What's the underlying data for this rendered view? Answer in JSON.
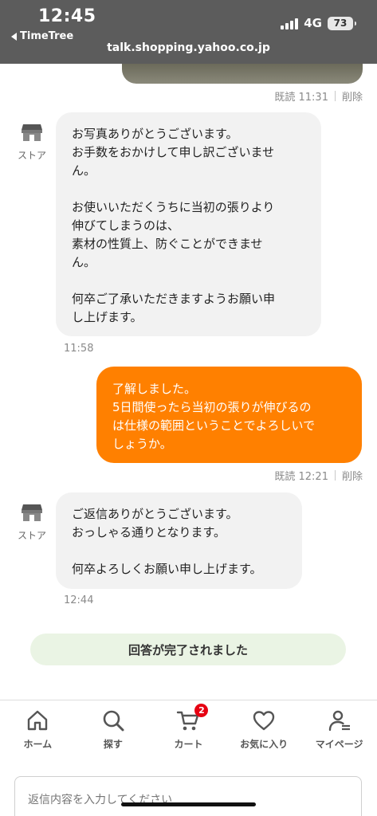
{
  "status_bar": {
    "time": "12:45",
    "back_app": "TimeTree",
    "network": "4G",
    "battery": "73",
    "url": "talk.shopping.yahoo.co.jp"
  },
  "chat": {
    "top_meta": {
      "read": "既読 11:31",
      "delete": "削除"
    },
    "store_label": "ストア",
    "message_1": {
      "text": "お写真ありがとうございます。\nお手数をおかけして申し訳ございませ\nん。\n\nお使いいただくうちに当初の張りより\n伸びてしまうのは、\n素材の性質上、防ぐことができませ\nん。\n\n何卒ご了承いただきますようお願い申\nし上げます。",
      "time": "11:58"
    },
    "reply": {
      "text": "了解しました。\n5日間使ったら当初の張りが伸びるの\nは仕様の範囲ということでよろしいで\nしょうか。",
      "read": "既読 12:21",
      "delete": "削除"
    },
    "message_2": {
      "text": "ご返信ありがとうございます。\nおっしゃる通りとなります。\n\n何卒よろしくお願い申し上げます。",
      "time": "12:44"
    },
    "completed": "回答が完了されました"
  },
  "nav": {
    "items": [
      {
        "label": "ホーム",
        "icon": "home-icon"
      },
      {
        "label": "探す",
        "icon": "search-icon"
      },
      {
        "label": "カート",
        "icon": "cart-icon",
        "badge": "2"
      },
      {
        "label": "お気に入り",
        "icon": "heart-icon"
      },
      {
        "label": "マイページ",
        "icon": "user-icon"
      }
    ]
  },
  "input": {
    "placeholder": "返信内容を入力してください"
  },
  "colors": {
    "accent": "#ff8000",
    "status_bar": "#5c5c5c",
    "incoming_bubble": "#f2f2f2",
    "done_pill": "#eaf4e4",
    "badge": "#e60012"
  }
}
